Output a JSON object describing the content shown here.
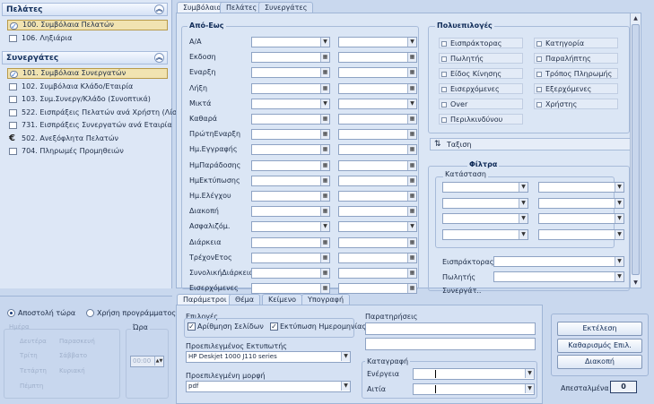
{
  "left_panel": {
    "clients": {
      "title": "Πελάτες",
      "items": [
        {
          "label": "100. Συμβόλαια Πελατών",
          "selected": true,
          "icon": "check-circle-icon"
        },
        {
          "label": "106. Ληξιάρια",
          "selected": false,
          "icon": "doc-icon"
        }
      ]
    },
    "partners": {
      "title": "Συνεργάτες",
      "items": [
        {
          "label": "101. Συμβόλαια Συνεργατών",
          "selected": true,
          "icon": "check-circle-icon"
        },
        {
          "label": "102. Συμβόλαια Κλάδο/Εταιρία",
          "selected": false,
          "icon": "doc-icon"
        },
        {
          "label": "103. Συμ.Συνεργ/Κλάδο (Συνοπτικά)",
          "selected": false,
          "icon": "doc-icon"
        },
        {
          "label": "522. Εισπράξεις Πελατών ανά Χρήστη (Λίστα)",
          "selected": false,
          "icon": "doc-icon"
        },
        {
          "label": "731. Εισπράξεις Συνεργατών ανά Εταιρία",
          "selected": false,
          "icon": "doc-icon"
        },
        {
          "label": "502. Ανεξόφλητα Πελατών",
          "selected": false,
          "icon": "euro-icon"
        },
        {
          "label": "704. Πληρωμές Προμηθειών",
          "selected": false,
          "icon": "doc-icon"
        }
      ]
    }
  },
  "top_tabs": [
    "Συμβόλαια",
    "Πελάτες",
    "Συνεργάτες"
  ],
  "apo_eos": {
    "title": "Από-Εως",
    "rows": [
      {
        "label": "Α/Α",
        "kind": "dd"
      },
      {
        "label": "Εκδοση",
        "kind": "cal"
      },
      {
        "label": "Εναρξη",
        "kind": "cal"
      },
      {
        "label": "Λήξη",
        "kind": "cal"
      },
      {
        "label": "Μικτά",
        "kind": "dd"
      },
      {
        "label": "Καθαρά",
        "kind": "cal"
      },
      {
        "label": "ΠρώτηΕναρξη",
        "kind": "cal"
      },
      {
        "label": "Ημ.Εγγραφής",
        "kind": "cal"
      },
      {
        "label": "ΗμΠαράδοσης",
        "kind": "cal"
      },
      {
        "label": "ΗμΕκτύπωσης",
        "kind": "cal"
      },
      {
        "label": "Ημ.Ελέγχου",
        "kind": "cal"
      },
      {
        "label": "Διακοπή",
        "kind": "cal"
      },
      {
        "label": "Ασφαλιζόμ.",
        "kind": "dd"
      },
      {
        "label": "Διάρκεια",
        "kind": "cal"
      },
      {
        "label": "ΤρέχονΕτος",
        "kind": "cal"
      },
      {
        "label": "ΣυνολικήΔιάρκεια",
        "kind": "cal"
      },
      {
        "label": "Εισερχόμενες",
        "kind": "cal"
      }
    ]
  },
  "multi": {
    "title": "Πολυεπιλογές",
    "col1": [
      "Εισπράκτορας",
      "Πωλητής",
      "Είδος Κίνησης",
      "Εισερχόμενες",
      "Over",
      "Περιλκινδύνου"
    ],
    "col2": [
      "Κατηγορία",
      "Παραλήπτης",
      "Τρόπος Πληρωμής",
      "Εξερχόμενες",
      "Χρήστης"
    ]
  },
  "sort_label": "Ταξιση",
  "filters": {
    "title": "Φίλτρα",
    "status_label": "Κατάσταση",
    "collector_label": "Εισπράκτορας",
    "seller_label": "Πωλητής",
    "partner_label": "Συνεργάτ.."
  },
  "bottom_left": {
    "send_now": "Αποστολή τώρα",
    "use_schedule": "Χρήση προγράμματος",
    "days_label": "Ημέρα",
    "days": [
      "Δευτέρα",
      "Τρίτη",
      "Τετάρτη",
      "Πέμπτη",
      "Παρασκευή",
      "Σάββατο",
      "Κυριακή"
    ],
    "time_label": "Ώρα",
    "time_value": "00:00"
  },
  "param_tabs": [
    "Παράμετροι",
    "Θέμα",
    "Κείμενο",
    "Υπογραφή"
  ],
  "params": {
    "options_label": "Επιλογές",
    "page_numbering": "Αρίθμηση Σελίδων",
    "print_date": "Εκτύπωση Ημερομηνίας",
    "printer_label": "Προεπιλεγμένος Εκτυπωτής",
    "printer_value": "HP Deskjet 1000 J110 series",
    "format_label": "Προεπιλεγμένη μορφή",
    "format_value": "pdf",
    "notes_label": "Παρατηρήσεις",
    "log_label": "Καταγραφή",
    "action_label": "Ενέργεια",
    "reason_label": "Αιτία"
  },
  "actions": {
    "run": "Εκτέλεση",
    "clear": "Καθαρισμός Επιλ.",
    "stop": "Διακοπή",
    "sent_label": "Απεσταλμένα",
    "sent_count": "0"
  }
}
